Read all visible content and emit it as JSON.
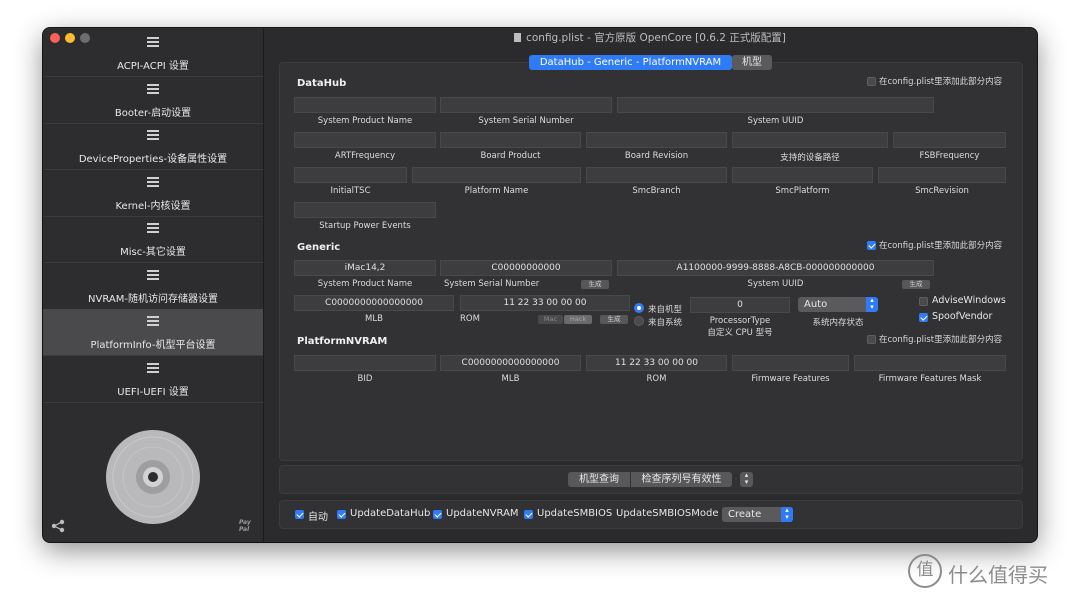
{
  "window": {
    "title": "config.plist - 官方原版 OpenCore [0.6.2 正式版配置]"
  },
  "sidebar": {
    "items": [
      {
        "label": "ACPI-ACPI 设置"
      },
      {
        "label": "Booter-启动设置"
      },
      {
        "label": "DeviceProperties-设备属性设置"
      },
      {
        "label": "Kernel-内核设置"
      },
      {
        "label": "Misc-其它设置"
      },
      {
        "label": "NVRAM-随机访问存储器设置"
      },
      {
        "label": "PlatformInfo-机型平台设置"
      },
      {
        "label": "UEFI-UEFI 设置"
      }
    ],
    "paypal": "Pay Pal"
  },
  "tabs": {
    "main": "DataHub - Generic - PlatformNVRAM",
    "model": "机型"
  },
  "datahub": {
    "title": "DataHub",
    "add_label": "在config.plist里添加此部分内容",
    "fields": {
      "system_product_name": "System Product Name",
      "system_serial_number": "System Serial Number",
      "system_uuid": "System UUID",
      "art_frequency": "ARTFrequency",
      "board_product": "Board Product",
      "board_revision": "Board Revision",
      "device_path": "支持的设备路径",
      "fsb_frequency": "FSBFrequency",
      "initial_tsc": "InitialTSC",
      "platform_name": "Platform Name",
      "smc_branch": "SmcBranch",
      "smc_platform": "SmcPlatform",
      "smc_revision": "SmcRevision",
      "startup_power_events": "Startup Power Events"
    }
  },
  "generic": {
    "title": "Generic",
    "add_label": "在config.plist里添加此部分内容",
    "system_product_name": {
      "value": "iMac14,2",
      "label": "System Product Name"
    },
    "system_serial_number": {
      "value": "C00000000000",
      "label": "System Serial Number"
    },
    "system_uuid": {
      "value": "A1100000-9999-8888-A8CB-000000000000",
      "label": "System UUID"
    },
    "mlb": {
      "value": "C0000000000000000",
      "label": "MLB"
    },
    "rom": {
      "value": "11 22 33 00 00 00",
      "label": "ROM"
    },
    "generate": "生成",
    "mac": "Mac",
    "hack": "Hack",
    "from_model": "来自机型",
    "from_system": "来自系统",
    "processor_type": {
      "value": "0",
      "label": "ProcessorType",
      "sublabel": "自定义 CPU 型号"
    },
    "memory_status": {
      "value": "Auto",
      "label": "系统内存状态"
    },
    "advise_windows": "AdviseWindows",
    "spoof_vendor": "SpoofVendor"
  },
  "platform_nvram": {
    "title": "PlatformNVRAM",
    "add_label": "在config.plist里添加此部分内容",
    "bid": {
      "label": "BID"
    },
    "mlb": {
      "value": "C0000000000000000",
      "label": "MLB"
    },
    "rom": {
      "value": "11 22 33 00 00 00",
      "label": "ROM"
    },
    "firmware_features": {
      "label": "Firmware Features"
    },
    "firmware_features_mask": {
      "label": "Firmware Features Mask"
    }
  },
  "lookup": {
    "model_query": "机型查询",
    "check_serial": "检查序列号有效性"
  },
  "bottom": {
    "auto": "自动",
    "update_datahub": "UpdateDataHub",
    "update_nvram": "UpdateNVRAM",
    "update_smbios": "UpdateSMBIOS",
    "update_smbios_mode_label": "UpdateSMBIOSMode",
    "update_smbios_mode_value": "Create"
  },
  "watermark": {
    "text": "什么值得买",
    "mark": "值"
  },
  "colors": {
    "accent": "#2f7bf5",
    "close": "#fe5f57",
    "minimize": "#febc2e",
    "zoom": "#6e6e6e"
  }
}
